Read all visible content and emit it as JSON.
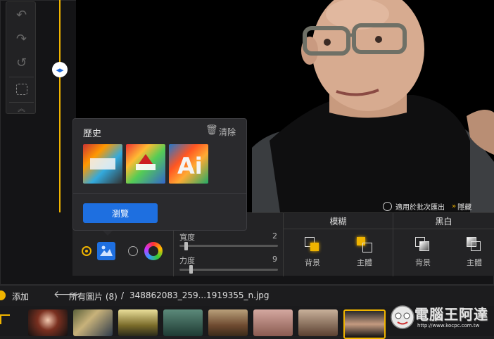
{
  "history": {
    "title": "歷史",
    "clear_label": "清除",
    "browse_label": "瀏覽"
  },
  "apply_batch": {
    "label": "適用於批次匯出",
    "hide_label": "隱藏"
  },
  "effects": {
    "blur_header": "模糊",
    "bw_header": "黑白",
    "strength_label": "寬度",
    "strength_value": "2",
    "force_label": "力度",
    "force_value": "9",
    "strength_level": 0.05,
    "force_level": 0.1,
    "blur_bg_label": "背景",
    "blur_subject_label": "主體",
    "bw_bg_label": "背景",
    "bw_subject_label": "主體"
  },
  "bottom": {
    "add_label": "添加",
    "all_images_label": "所有圖片 (8)",
    "separator": "/",
    "file_name": "348862083_259...1919355_n.jpg"
  },
  "watermark": {
    "title": "電腦王阿達",
    "url": "http://www.kocpc.com.tw"
  },
  "colors": {
    "accent": "#f0b400",
    "primary": "#1e6fe0"
  }
}
